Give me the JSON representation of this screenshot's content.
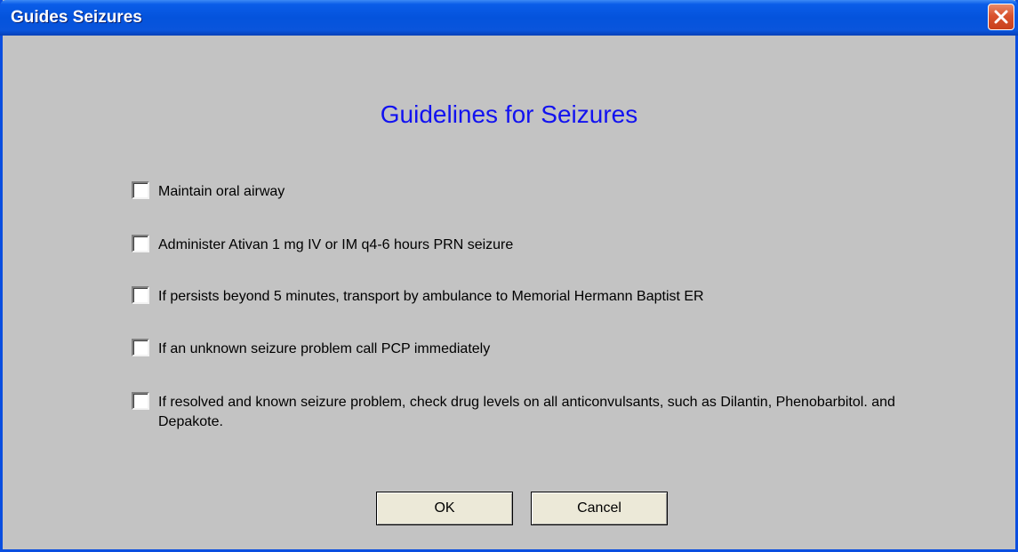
{
  "window": {
    "title": "Guides Seizures"
  },
  "heading": "Guidelines for Seizures",
  "items": [
    {
      "label": "Maintain oral airway",
      "checked": false
    },
    {
      "label": "Administer Ativan 1 mg IV or IM q4-6 hours PRN seizure",
      "checked": false
    },
    {
      "label": "If persists beyond 5 minutes, transport by ambulance to Memorial Hermann Baptist ER",
      "checked": false
    },
    {
      "label": "If an unknown seizure problem call PCP immediately",
      "checked": false
    },
    {
      "label": "If resolved and known seizure problem, check drug levels on all anticonvulsants, such as Dilantin, Phenobarbitol. and Depakote.",
      "checked": false
    }
  ],
  "buttons": {
    "ok": "OK",
    "cancel": "Cancel"
  },
  "icons": {
    "close": "close-icon"
  },
  "colors": {
    "titlebar": "#0453dc",
    "heading": "#1212f0",
    "close_button": "#d9532e",
    "dialog_background": "#c3c3c3"
  }
}
